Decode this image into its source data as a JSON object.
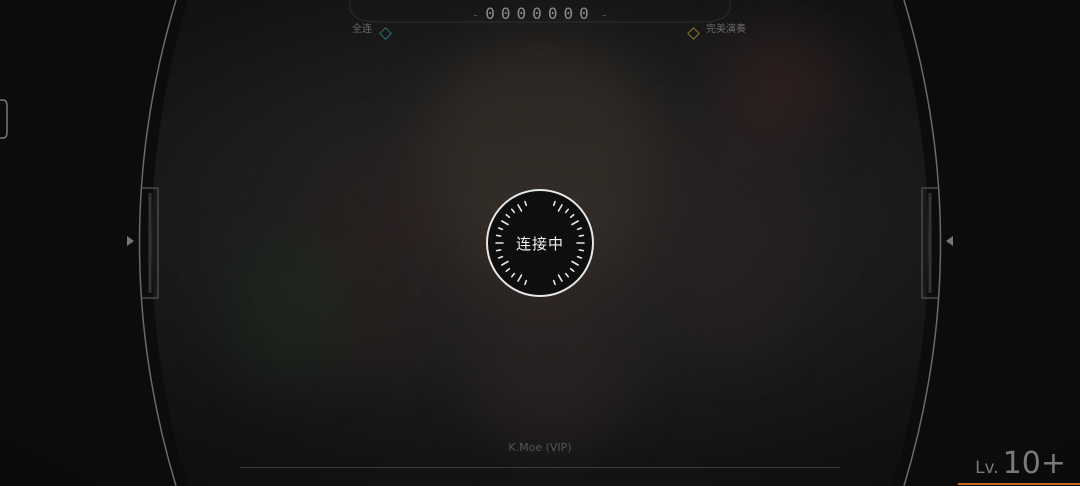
{
  "score": {
    "value": "0000000",
    "dash_left": "-",
    "dash_right": "-"
  },
  "badges": {
    "full_combo_label": "全连",
    "all_perfect_label": "完美演奏",
    "full_combo_color": "#2f6f74",
    "all_perfect_color": "#8c7a2a"
  },
  "status": {
    "text": "连接中"
  },
  "player": {
    "name": "K.Moe (VIP)"
  },
  "level": {
    "prefix": "Lv.",
    "value": "10+",
    "accent_color": "#c46a1f"
  },
  "icons": {
    "left_arrow": "left-nav-arrow-icon",
    "right_arrow": "right-nav-arrow-icon",
    "loading": "loading-ring-icon"
  }
}
